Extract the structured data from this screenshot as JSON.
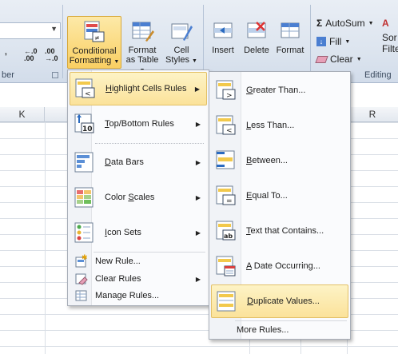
{
  "ribbon": {
    "number_group_label": "ber",
    "editing_group_label": "Editing",
    "decrease_decimal": ",0\n.00",
    "increase_decimal": ".00\n,0",
    "conditional_formatting": {
      "line1": "Conditional",
      "line2": "Formatting"
    },
    "format_as_table": {
      "line1": "Format",
      "line2": "as Table"
    },
    "cell_styles": {
      "line1": "Cell",
      "line2": "Styles"
    },
    "insert": "Insert",
    "delete": "Delete",
    "format": "Format",
    "autosum": "AutoSum",
    "fill": "Fill",
    "clear": "Clear",
    "sort_line1": "Sor",
    "sort_line2": "Filte"
  },
  "sheet": {
    "col_k": "K",
    "col_r": "R"
  },
  "cf_menu": {
    "items": [
      {
        "label": "Highlight Cells Rules",
        "mnemonic": "H"
      },
      {
        "label": "Top/Bottom Rules",
        "mnemonic": "T"
      },
      {
        "label": "Data Bars",
        "mnemonic": "D"
      },
      {
        "label": "Color Scales",
        "mnemonic": "S"
      },
      {
        "label": "Icon Sets",
        "mnemonic": "I"
      }
    ],
    "new_rule": "New Rule...",
    "clear_rules": "Clear Rules",
    "manage_rules": "Manage Rules..."
  },
  "highlight_menu": {
    "items": [
      "Greater Than...",
      "Less Than...",
      "Between...",
      "Equal To...",
      "Text that Contains...",
      "A Date Occurring...",
      "Duplicate Values..."
    ],
    "more_rules": "More Rules..."
  },
  "colors": {
    "ribbon_bg": "#dde5ef",
    "highlight": "#fbe29a",
    "highlight_border": "#e3c067",
    "menu_bg": "#fafbfd"
  }
}
